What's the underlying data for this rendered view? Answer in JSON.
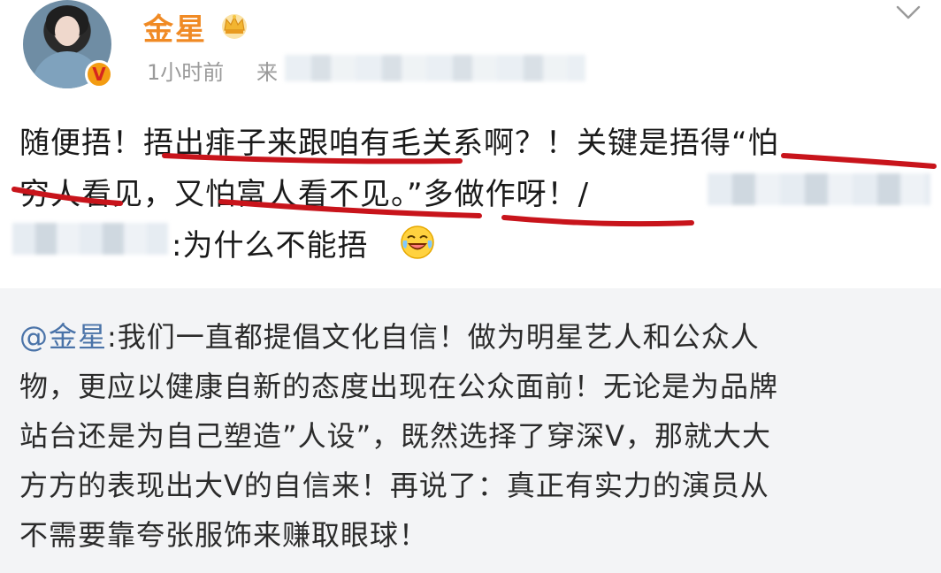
{
  "post": {
    "author": "金星",
    "time": "1小时前",
    "source_prefix": "来",
    "body_line1": "随便捂！捂出痱子来跟咱有毛关系啊？！关键是捂得“怕",
    "body_line2": "穷人看见，又怕富人看不见。”多做作呀！/",
    "body_line3": ":为什么不能捂"
  },
  "repost": {
    "mention": "@金星",
    "line1_rest": ":我们一直都提倡文化自信！做为明星艺人和公众人",
    "line2": "物，更应以健康自新的态度出现在公众面前！无论是为品牌",
    "line3": "站台还是为自己塑造”人设”，既然选择了穿深V，那就大大",
    "line4": "方方的表现出大V的自信来！再说了：真正有实力的演员从",
    "line5": "不需要靠夸张服饰来赚取眼球！"
  },
  "badges": {
    "verified": "V"
  },
  "icons": {
    "crown": "crown-icon",
    "chevron": "chevron-down-icon",
    "emoji": "laugh-cry-emoji-icon"
  },
  "colors": {
    "author": "#f08a24",
    "underline": "#c8141b",
    "mention": "#4a73a8",
    "repost_bg": "#f3f4f6"
  }
}
